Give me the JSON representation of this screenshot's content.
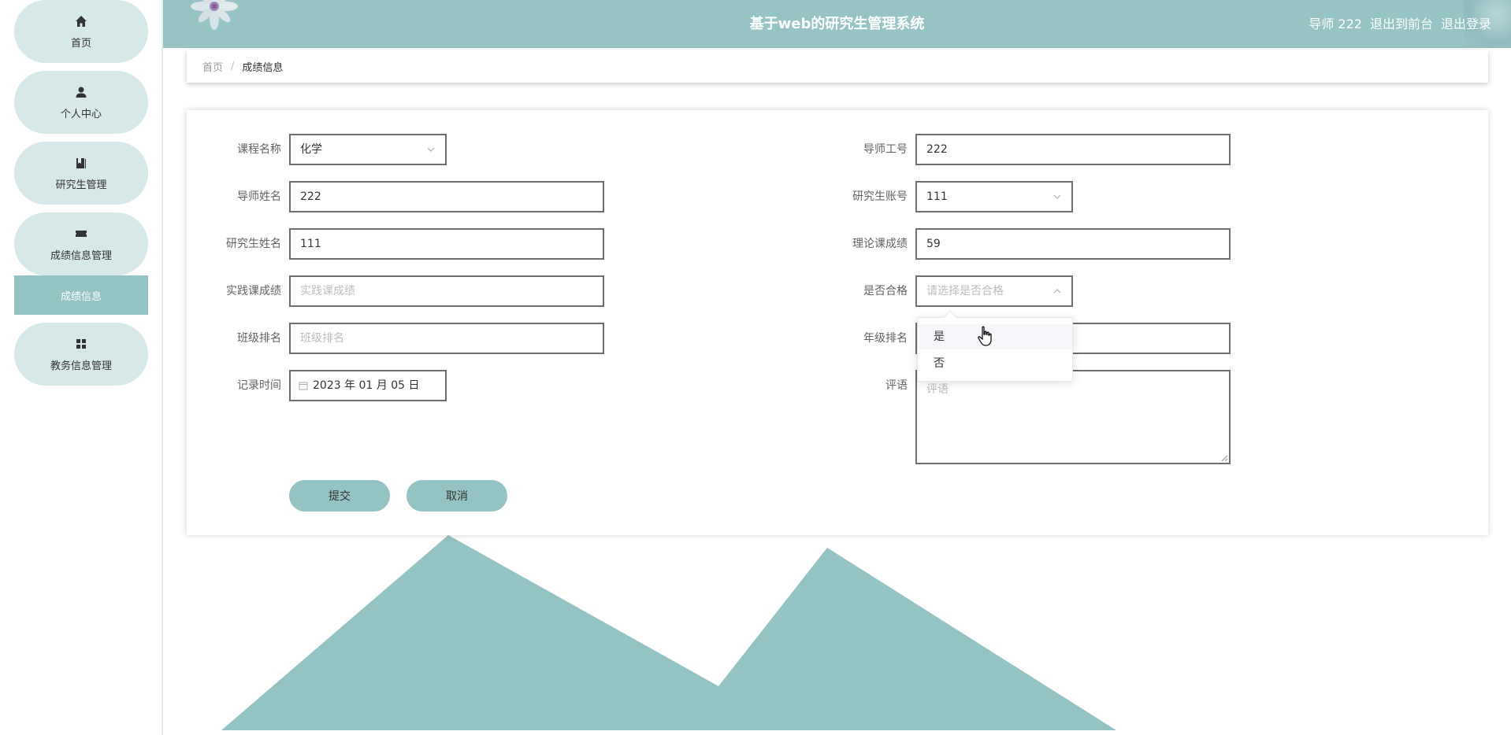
{
  "header": {
    "title": "基于web的研究生管理系统",
    "user_label": "导师 222",
    "front_label": "退出到前台",
    "logout_label": "退出登录"
  },
  "sidebar": {
    "items": [
      {
        "label": "首页",
        "icon": "home-icon"
      },
      {
        "label": "个人中心",
        "icon": "user-icon"
      },
      {
        "label": "研究生管理",
        "icon": "book-icon"
      },
      {
        "label": "成绩信息管理",
        "icon": "ticket-icon"
      },
      {
        "label": "教务信息管理",
        "icon": "grid-icon"
      }
    ],
    "sub_active": "成绩信息"
  },
  "breadcrumb": {
    "home": "首页",
    "separator": "/",
    "current": "成绩信息"
  },
  "form": {
    "course_label": "课程名称",
    "course_value": "化学",
    "teacher_id_label": "导师工号",
    "teacher_id_value": "222",
    "teacher_name_label": "导师姓名",
    "teacher_name_value": "222",
    "student_account_label": "研究生账号",
    "student_account_value": "111",
    "student_name_label": "研究生姓名",
    "student_name_value": "111",
    "theory_label": "理论课成绩",
    "theory_value": "59",
    "practice_label": "实践课成绩",
    "practice_placeholder": "实践课成绩",
    "pass_label": "是否合格",
    "pass_placeholder": "请选择是否合格",
    "class_rank_label": "班级排名",
    "class_rank_placeholder": "班级排名",
    "grade_rank_label": "年级排名",
    "record_time_label": "记录时间",
    "record_time_value": "2023 年 01 月 05 日",
    "comment_label": "评语",
    "comment_placeholder": "评语",
    "submit_label": "提交",
    "cancel_label": "取消"
  },
  "dropdown": {
    "options": [
      "是",
      "否"
    ],
    "hovered": "是"
  },
  "colors": {
    "accent": "#94c3c3",
    "sidebar_item_bg": "#d6e8e7",
    "header_bg": "#96c4c5"
  }
}
